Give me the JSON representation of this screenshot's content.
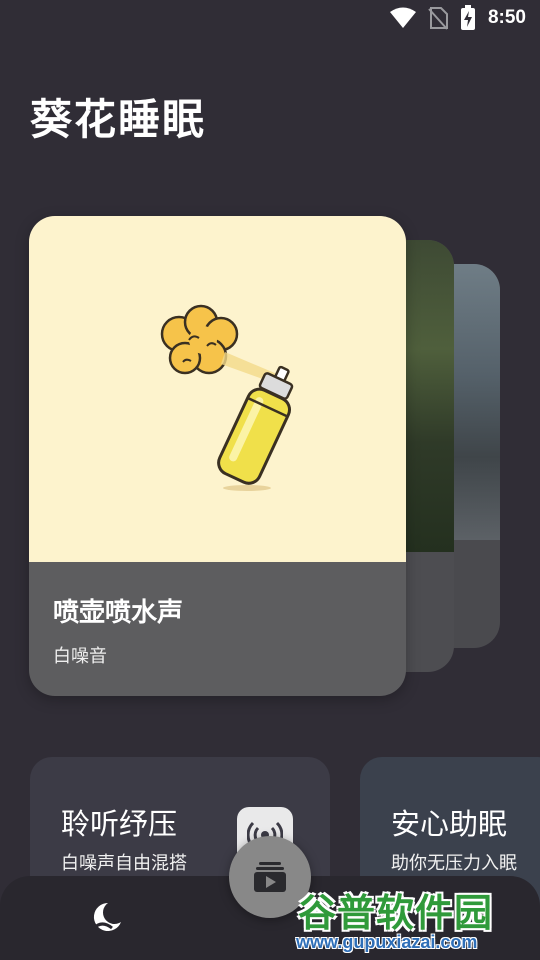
{
  "status_bar": {
    "time": "8:50",
    "icons": [
      "wifi-icon",
      "no-sim-icon",
      "battery-charging-icon"
    ]
  },
  "app": {
    "title": "葵花睡眠"
  },
  "featured_card": {
    "title": "喷壶喷水声",
    "category": "白噪音",
    "illustration": "spray-can-icon",
    "art_background": "#fdf3cd"
  },
  "feature_cards": [
    {
      "title": "聆听纾压",
      "subtitle": "白噪声自由混搭",
      "icon": "broadcast-icon"
    },
    {
      "title": "安心助眠",
      "subtitle": "助你无压力入眠"
    }
  ],
  "bottom_nav": {
    "items": [
      "moon-icon",
      "play-list-icon"
    ]
  },
  "watermark": {
    "title": "谷普软件园",
    "url": "www.gupuxiazai.com"
  }
}
